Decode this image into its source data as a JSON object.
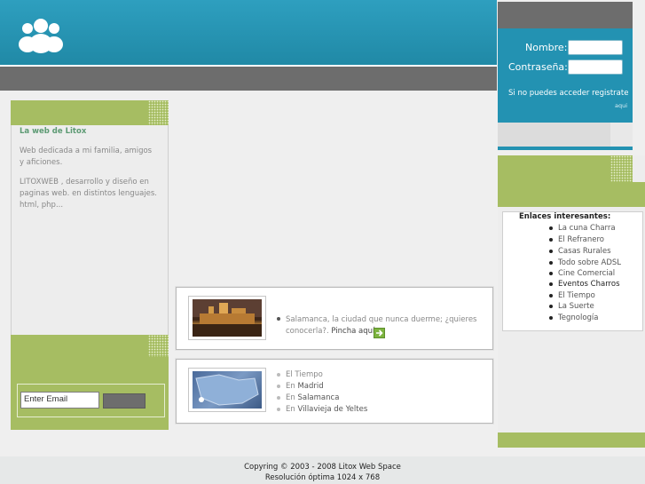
{
  "colors": {
    "teal": "#2392b2",
    "gray": "#6d6d6d",
    "green": "#a6bd62",
    "title_green": "#5c9a73"
  },
  "header": {
    "logo_icon": "users-group-icon"
  },
  "login": {
    "name_label": "Nombre:",
    "password_label": "Contraseña:",
    "info_text": "Si no puedes acceder registrate",
    "submit_label": "aqui"
  },
  "left": {
    "title": "La web de Litox",
    "desc1": "Web dedicada a mi familia, amigos y aficiones.",
    "desc2": "LITOXWEB , desarrollo y diseño en paginas web. en distintos lenguajes. html, php...",
    "email_value": "Enter Email"
  },
  "center": {
    "box1": {
      "text": "Salamanca, la ciudad que nunca duerme; ¿quieres conocerla?.",
      "link": "Pincha aquí",
      "arrow_icon": "arrow-right-icon"
    },
    "box2": {
      "items": [
        {
          "prefix": "El Tiempo",
          "city": ""
        },
        {
          "prefix": "En ",
          "city": "Madrid"
        },
        {
          "prefix": "En ",
          "city": "Salamanca"
        },
        {
          "prefix": "En ",
          "city": "Villavieja de Yeltes"
        }
      ]
    }
  },
  "right": {
    "links_title": "Enlaces interesantes:",
    "links": [
      "La cuna Charra",
      "El Refranero",
      "Casas Rurales",
      "Todo sobre ADSL",
      "Cine Comercial",
      "Eventos Charros",
      "El Tiempo",
      "La Suerte",
      "Tegnología"
    ]
  },
  "footer": {
    "line1": "Copyring © 2003 - 2008 Litox Web Space",
    "line2": "Resolución óptima 1024 x 768"
  }
}
